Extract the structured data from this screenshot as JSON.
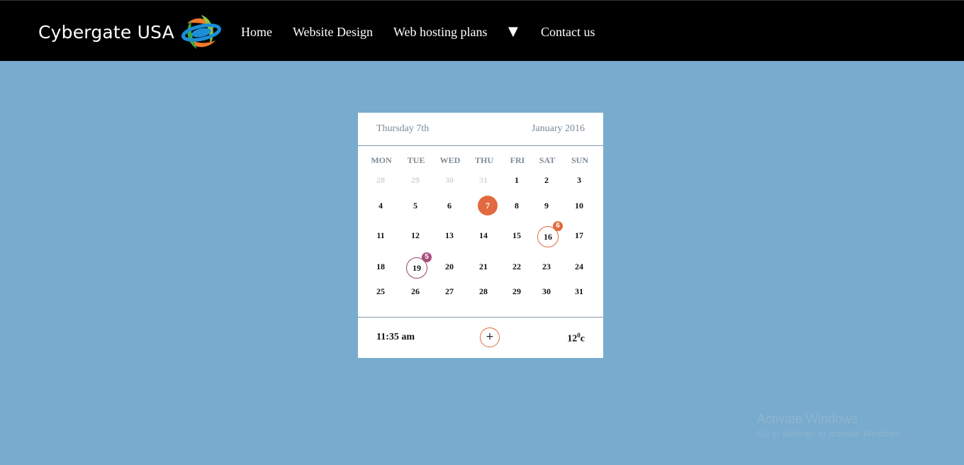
{
  "navbar": {
    "brand": "Cybergate USA",
    "logo_icon": "cybergate-swirl-logo",
    "items": [
      {
        "label": "Home"
      },
      {
        "label": "Website Design"
      },
      {
        "label": "Web hosting plans"
      },
      {
        "label": "▼"
      },
      {
        "label": "Contact us"
      }
    ]
  },
  "calendar": {
    "day_label": "Thursday 7th",
    "month_label": "January 2016",
    "weekdays": [
      "MON",
      "TUE",
      "WED",
      "THU",
      "FRI",
      "SAT",
      "SUN"
    ],
    "weeks": [
      [
        "28",
        "29",
        "30",
        "31",
        "1",
        "2",
        "3"
      ],
      [
        "4",
        "5",
        "6",
        "7",
        "8",
        "9",
        "10"
      ],
      [
        "11",
        "12",
        "13",
        "14",
        "15",
        "16",
        "17"
      ],
      [
        "18",
        "19",
        "20",
        "21",
        "22",
        "23",
        "24"
      ],
      [
        "25",
        "26",
        "27",
        "28",
        "29",
        "30",
        "31"
      ]
    ],
    "events": {
      "16": "6",
      "19": "5"
    },
    "footer": {
      "time": "11:35 am",
      "add_label": "+",
      "temp_value": "12",
      "temp_degree": "0",
      "temp_unit": "c"
    }
  },
  "watermark": {
    "title": "Activate Windows",
    "subtitle": "Go to Settings to activate Windows."
  },
  "colors": {
    "background": "#78abcd",
    "accent_orange": "#e26a40",
    "accent_purple": "#a84f7d"
  }
}
